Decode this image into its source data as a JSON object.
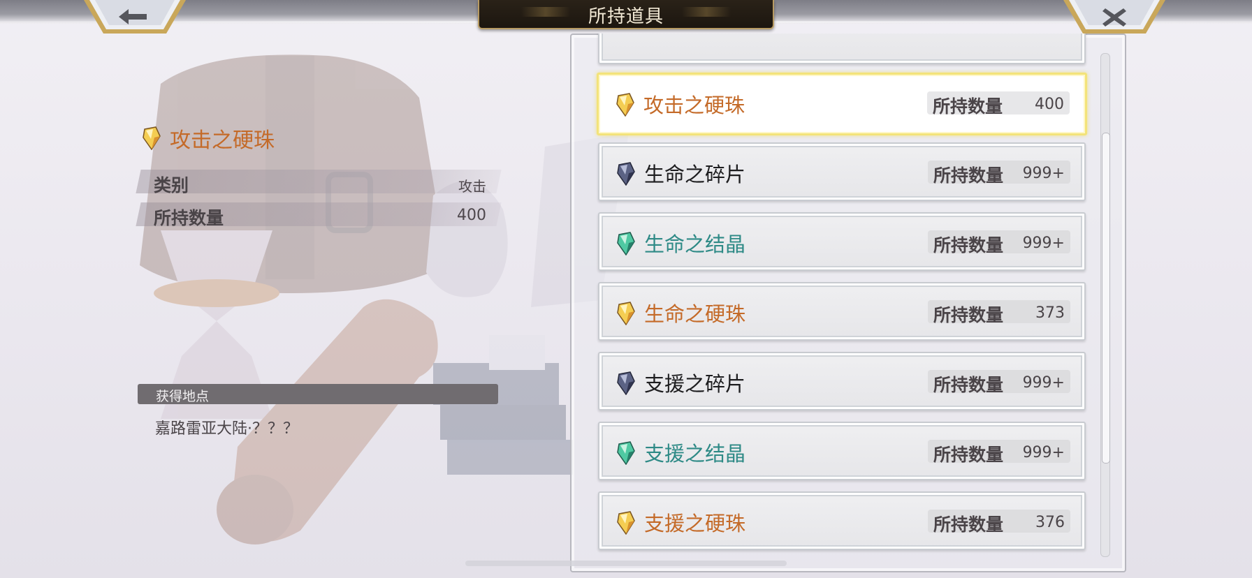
{
  "header": {
    "title": "所持道具",
    "back_icon": "arrow-left-icon",
    "close_icon": "close-x-icon"
  },
  "detail": {
    "name": "攻击之硬珠",
    "icon": "gold-gem-icon",
    "category_label": "类别",
    "category_value": "攻击",
    "quantity_label": "所持数量",
    "quantity_value": "400",
    "obtain_header": "获得地点",
    "obtain_location": "嘉路雷亚大陆·？？？"
  },
  "items": [
    {
      "name": "攻击之硬珠",
      "qty_label": "所持数量",
      "qty": "400",
      "gem": "gold",
      "color": "#c46a28",
      "selected": true
    },
    {
      "name": "生命之碎片",
      "qty_label": "所持数量",
      "qty": "999+",
      "gem": "dark",
      "color": "#1d1d1f",
      "selected": false
    },
    {
      "name": "生命之结晶",
      "qty_label": "所持数量",
      "qty": "999+",
      "gem": "green",
      "color": "#2e8a86",
      "selected": false
    },
    {
      "name": "生命之硬珠",
      "qty_label": "所持数量",
      "qty": "373",
      "gem": "gold",
      "color": "#c46a28",
      "selected": false
    },
    {
      "name": "支援之碎片",
      "qty_label": "所持数量",
      "qty": "999+",
      "gem": "dark",
      "color": "#1d1d1f",
      "selected": false
    },
    {
      "name": "支援之结晶",
      "qty_label": "所持数量",
      "qty": "999+",
      "gem": "green",
      "color": "#2e8a86",
      "selected": false
    },
    {
      "name": "支援之硬珠",
      "qty_label": "所持数量",
      "qty": "376",
      "gem": "gold",
      "color": "#c46a28",
      "selected": false
    }
  ],
  "colors": {
    "accent_orange": "#c46a28",
    "teal": "#2e8a86",
    "selected_border": "#f3e37a"
  }
}
